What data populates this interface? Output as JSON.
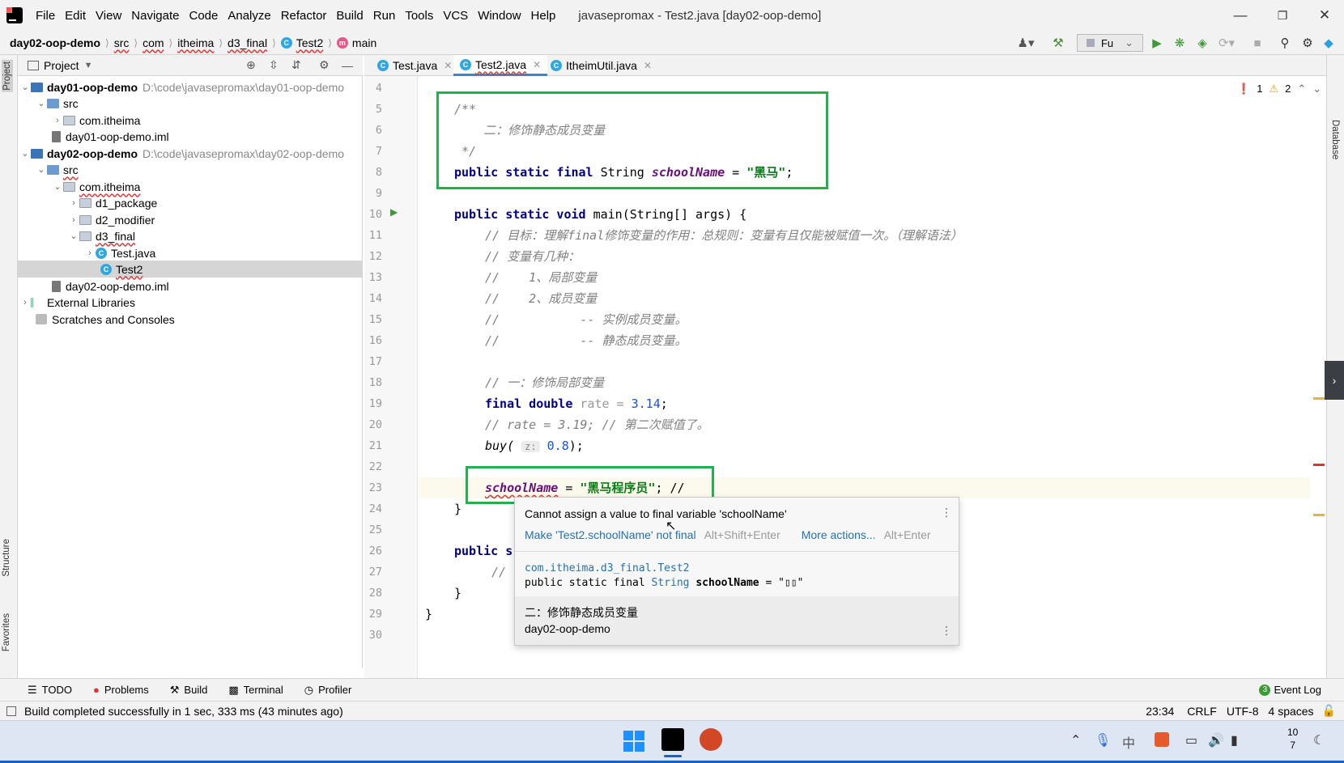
{
  "menu": {
    "items": [
      "File",
      "Edit",
      "View",
      "Navigate",
      "Code",
      "Analyze",
      "Refactor",
      "Build",
      "Run",
      "Tools",
      "VCS",
      "Window",
      "Help"
    ],
    "title": "javasepromax - Test2.java [day02-oop-demo]"
  },
  "breadcrumb": [
    "day02-oop-demo",
    "src",
    "com",
    "itheima",
    "d3_final",
    "Test2",
    "main"
  ],
  "toolbar": {
    "run_config": "Fu"
  },
  "project": {
    "title": "Project",
    "tree": [
      {
        "label": "day01-oop-demo",
        "path": "D:\\code\\javasepromax\\day01-oop-demo"
      },
      {
        "label": "src"
      },
      {
        "label": "com.itheima"
      },
      {
        "label": "day01-oop-demo.iml"
      },
      {
        "label": "day02-oop-demo",
        "path": "D:\\code\\javasepromax\\day02-oop-demo"
      },
      {
        "label": "src"
      },
      {
        "label": "com.itheima"
      },
      {
        "label": "d1_package"
      },
      {
        "label": "d2_modifier"
      },
      {
        "label": "d3_final"
      },
      {
        "label": "Test.java"
      },
      {
        "label": "Test2"
      },
      {
        "label": "day02-oop-demo.iml"
      },
      {
        "label": "External Libraries"
      },
      {
        "label": "Scratches and Consoles"
      }
    ]
  },
  "tabs": [
    "Test.java",
    "Test2.java",
    "ItheimUtil.java"
  ],
  "inspections": {
    "errors": "1",
    "warnings": "2"
  },
  "line_numbers": [
    "4",
    "5",
    "6",
    "7",
    "8",
    "9",
    "10",
    "11",
    "12",
    "13",
    "14",
    "15",
    "16",
    "17",
    "18",
    "19",
    "20",
    "21",
    "22",
    "23",
    "24",
    "25",
    "26",
    "27",
    "28",
    "29",
    "30"
  ],
  "code": {
    "l5": "/**",
    "l6": "    二：修饰静态成员变量",
    "l7": " */",
    "l8_a": "public static final ",
    "l8_b": "String ",
    "l8_c": "schoolName",
    "l8_d": " = ",
    "l8_e": "\"黑马\"",
    "l8_f": ";",
    "l10_a": "public static void ",
    "l10_b": "main(String[] args) {",
    "l11": "// 目标：理解final修饰变量的作用：总规则：变量有且仅能被赋值一次。（理解语法）",
    "l12": "// 变量有几种：",
    "l13": "//    1、局部变量",
    "l14": "//    2、成员变量",
    "l15": "//           -- 实例成员变量。",
    "l16": "//           -- 静态成员变量。",
    "l18": "// 一：修饰局部变量",
    "l19_a": "final double ",
    "l19_b": "rate = ",
    "l19_c": "3.14",
    "l19_d": ";",
    "l20": "// rate = 3.19; // 第二次赋值了。",
    "l21_a": "buy(",
    "l21_hint": "z:",
    "l21_c": "0.8",
    "l21_d": ");",
    "l23_a": "schoolName",
    "l23_b": " = ",
    "l23_c": "\"黑马程序员\"",
    "l23_d": "; //",
    "l24": "}",
    "l26": "public s",
    "l27": "//",
    "l28": "}",
    "l29": "}"
  },
  "popup": {
    "message": "Cannot assign a value to final variable 'schoolName'",
    "fix": "Make 'Test2.schoolName' not final",
    "fix_key": "Alt+Shift+Enter",
    "more": "More actions...",
    "more_key": "Alt+Enter",
    "qualified": "com.itheima.d3_final.Test2",
    "decl_a": "public static final ",
    "decl_b": "String",
    "decl_c": "schoolName",
    "decl_d": " = \"▯▯\"",
    "doc": "二：修饰静态成员变量",
    "module": "day02-oop-demo"
  },
  "bottom": {
    "todo": "TODO",
    "problems": "Problems",
    "build": "Build",
    "terminal": "Terminal",
    "profiler": "Profiler",
    "event_log": "Event Log",
    "event_count": "3"
  },
  "status": {
    "message": "Build completed successfully in 1 sec, 333 ms (43 minutes ago)",
    "position": "23:34",
    "line_sep": "CRLF",
    "encoding": "UTF-8",
    "indent": "4 spaces"
  },
  "side": {
    "project": "Project",
    "structure": "Structure",
    "favorites": "Favorites",
    "database": "Database"
  },
  "taskbar": {
    "time": "10",
    "date": "7"
  }
}
